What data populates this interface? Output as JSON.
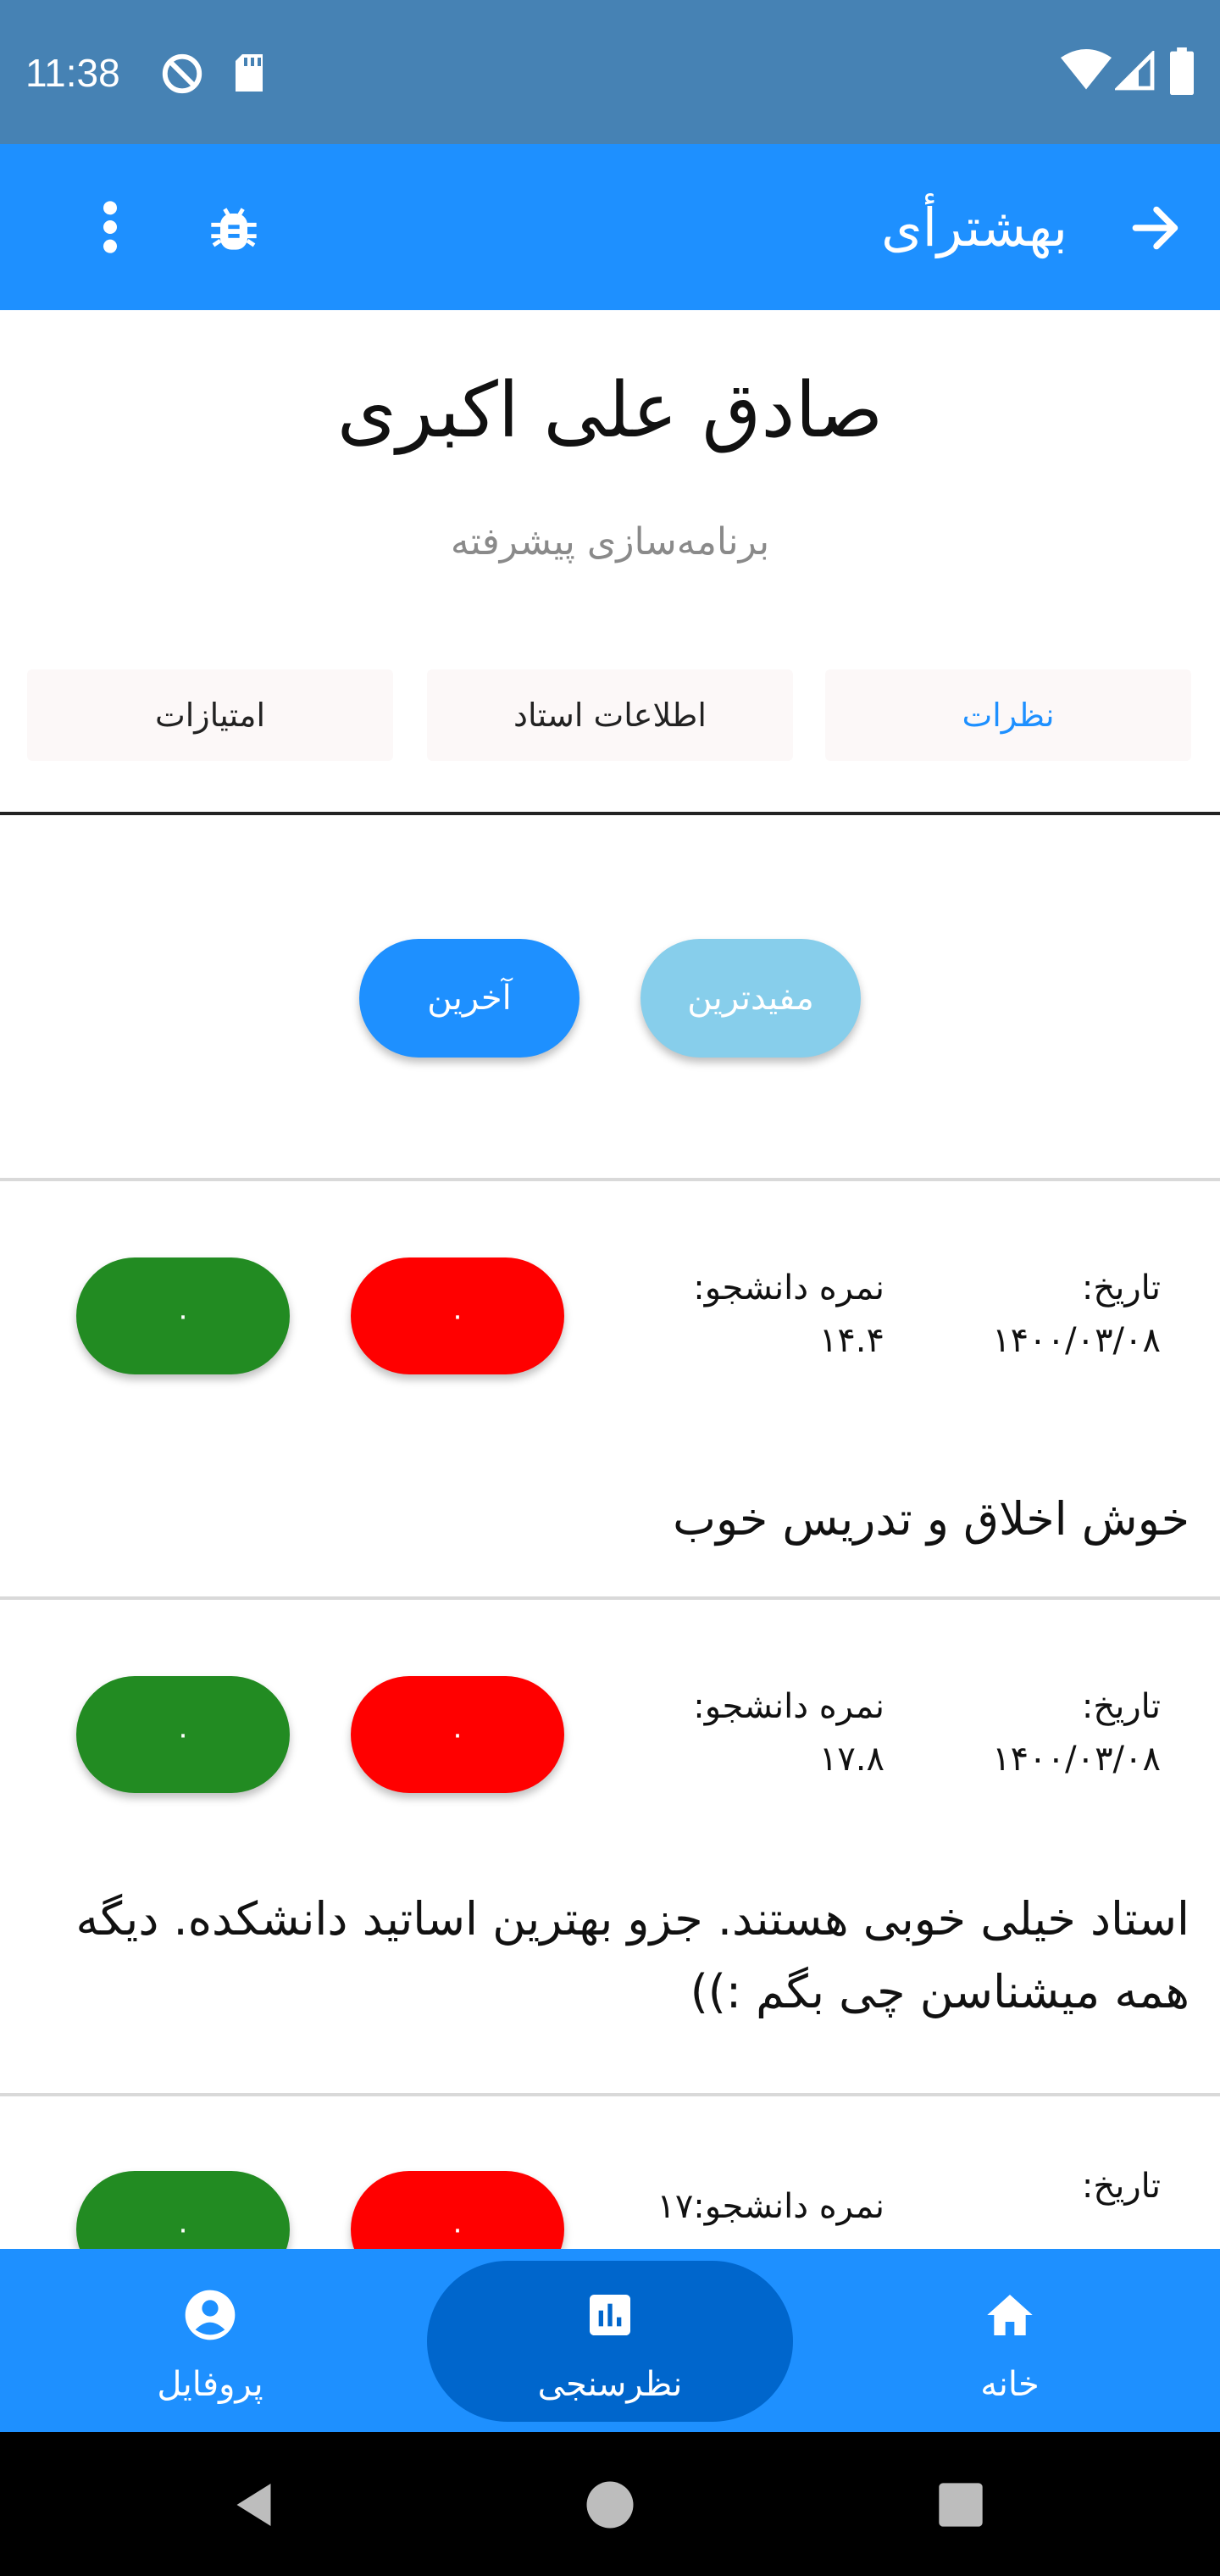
{
  "status_bar": {
    "time": "11:38",
    "icons": [
      "do-not-disturb-icon",
      "sd-card-icon",
      "wifi-icon",
      "signal-icon",
      "battery-icon"
    ]
  },
  "app_bar": {
    "title": "بهشترأی",
    "icons": [
      "back-arrow-icon",
      "bug-icon",
      "more-vert-icon"
    ]
  },
  "header": {
    "professor_name": "صادق علی اکبری",
    "course": "برنامه‌سازی پیشرفته"
  },
  "tabs": [
    {
      "label": "نظرات",
      "active": true
    },
    {
      "label": "اطلاعات استاد",
      "active": false
    },
    {
      "label": "امتیازات",
      "active": false
    }
  ],
  "sort": {
    "helpful_label": "مفیدترین",
    "latest_label": "آخرین"
  },
  "reviews": [
    {
      "date_label": "تاریخ:",
      "date": "۱۴۰۰/۰۳/۰۸",
      "grade_label": "نمره دانشجو:",
      "grade": "۱۴.۴",
      "dislikes": "۰",
      "likes": "۰",
      "text": "خوش اخلاق و تدریس خوب"
    },
    {
      "date_label": "تاریخ:",
      "date": "۱۴۰۰/۰۳/۰۸",
      "grade_label": "نمره دانشجو:",
      "grade": "۱۷.۸",
      "dislikes": "۰",
      "likes": "۰",
      "text": "استاد خیلی خوبی هستند. جزو بهترین اساتید دانشکده. دیگه همه میشناسن چی بگم :))"
    },
    {
      "date_label": "تاریخ:",
      "grade_label": "نمره دانشجو:۱۷",
      "dislikes": "۰",
      "likes": "۰"
    }
  ],
  "bottom_nav": [
    {
      "label": "خانه",
      "icon": "home-icon",
      "active": false
    },
    {
      "label": "نظرسنجی",
      "icon": "poll-icon",
      "active": true
    },
    {
      "label": "پروفایل",
      "icon": "account-circle-icon",
      "active": false
    }
  ],
  "system_nav": [
    "back-icon",
    "home-circle-icon",
    "recents-icon"
  ],
  "colors": {
    "status_bar": "#4682b4",
    "primary": "#1e90ff",
    "nav_active": "#0066cc",
    "helpful": "#87ceeb",
    "like": "#228b22",
    "dislike": "#ff0000"
  }
}
